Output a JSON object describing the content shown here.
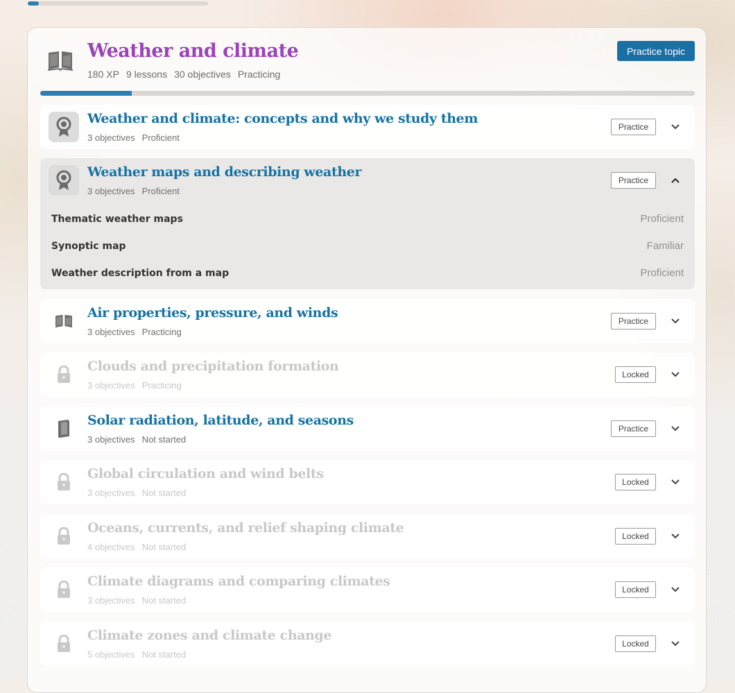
{
  "top_progress_fraction": 0.06,
  "topic": {
    "title": "Weather and climate",
    "xp": "180 XP",
    "lessons": "9 lessons",
    "objectives": "30 objectives",
    "status": "Practicing",
    "practice_button": "Practice topic",
    "progress_fraction": 0.14,
    "icon": "open-book-icon"
  },
  "lessons": [
    {
      "title": "Weather and climate: concepts and why we study them",
      "objectives": "3 objectives",
      "status": "Proficient",
      "button": "Practice",
      "icon": "badge-icon",
      "locked": false,
      "expanded": false
    },
    {
      "title": "Weather maps and describing weather",
      "objectives": "3 objectives",
      "status": "Proficient",
      "button": "Practice",
      "icon": "badge-icon",
      "locked": false,
      "expanded": true,
      "objective_items": [
        {
          "name": "Thematic weather maps",
          "status": "Proficient"
        },
        {
          "name": "Synoptic map",
          "status": "Familiar"
        },
        {
          "name": "Weather description from a map",
          "status": "Proficient"
        }
      ]
    },
    {
      "title": "Air properties, pressure, and winds",
      "objectives": "3 objectives",
      "status": "Practicing",
      "button": "Practice",
      "icon": "open-book-icon",
      "locked": false,
      "expanded": false
    },
    {
      "title": "Clouds and precipitation formation",
      "objectives": "3 objectives",
      "status": "Practicing",
      "button": "Locked",
      "icon": "lock-icon",
      "locked": true,
      "expanded": false
    },
    {
      "title": "Solar radiation, latitude, and seasons",
      "objectives": "3 objectives",
      "status": "Not started",
      "button": "Practice",
      "icon": "closed-book-icon",
      "locked": false,
      "expanded": false
    },
    {
      "title": "Global circulation and wind belts",
      "objectives": "3 objectives",
      "status": "Not started",
      "button": "Locked",
      "icon": "lock-icon",
      "locked": true,
      "expanded": false
    },
    {
      "title": "Oceans, currents, and relief shaping climate",
      "objectives": "4 objectives",
      "status": "Not started",
      "button": "Locked",
      "icon": "lock-icon",
      "locked": true,
      "expanded": false
    },
    {
      "title": "Climate diagrams and comparing climates",
      "objectives": "3 objectives",
      "status": "Not started",
      "button": "Locked",
      "icon": "lock-icon",
      "locked": true,
      "expanded": false
    },
    {
      "title": "Climate zones and climate change",
      "objectives": "5 objectives",
      "status": "Not started",
      "button": "Locked",
      "icon": "lock-icon",
      "locked": true,
      "expanded": false
    }
  ]
}
